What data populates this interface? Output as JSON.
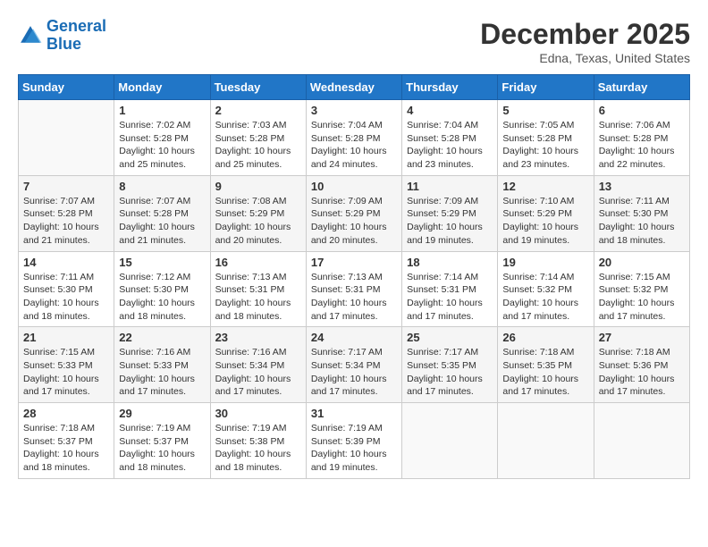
{
  "header": {
    "logo_line1": "General",
    "logo_line2": "Blue",
    "month": "December 2025",
    "location": "Edna, Texas, United States"
  },
  "weekdays": [
    "Sunday",
    "Monday",
    "Tuesday",
    "Wednesday",
    "Thursday",
    "Friday",
    "Saturday"
  ],
  "weeks": [
    [
      {
        "day": "",
        "info": ""
      },
      {
        "day": "1",
        "info": "Sunrise: 7:02 AM\nSunset: 5:28 PM\nDaylight: 10 hours\nand 25 minutes."
      },
      {
        "day": "2",
        "info": "Sunrise: 7:03 AM\nSunset: 5:28 PM\nDaylight: 10 hours\nand 25 minutes."
      },
      {
        "day": "3",
        "info": "Sunrise: 7:04 AM\nSunset: 5:28 PM\nDaylight: 10 hours\nand 24 minutes."
      },
      {
        "day": "4",
        "info": "Sunrise: 7:04 AM\nSunset: 5:28 PM\nDaylight: 10 hours\nand 23 minutes."
      },
      {
        "day": "5",
        "info": "Sunrise: 7:05 AM\nSunset: 5:28 PM\nDaylight: 10 hours\nand 23 minutes."
      },
      {
        "day": "6",
        "info": "Sunrise: 7:06 AM\nSunset: 5:28 PM\nDaylight: 10 hours\nand 22 minutes."
      }
    ],
    [
      {
        "day": "7",
        "info": "Sunrise: 7:07 AM\nSunset: 5:28 PM\nDaylight: 10 hours\nand 21 minutes."
      },
      {
        "day": "8",
        "info": "Sunrise: 7:07 AM\nSunset: 5:28 PM\nDaylight: 10 hours\nand 21 minutes."
      },
      {
        "day": "9",
        "info": "Sunrise: 7:08 AM\nSunset: 5:29 PM\nDaylight: 10 hours\nand 20 minutes."
      },
      {
        "day": "10",
        "info": "Sunrise: 7:09 AM\nSunset: 5:29 PM\nDaylight: 10 hours\nand 20 minutes."
      },
      {
        "day": "11",
        "info": "Sunrise: 7:09 AM\nSunset: 5:29 PM\nDaylight: 10 hours\nand 19 minutes."
      },
      {
        "day": "12",
        "info": "Sunrise: 7:10 AM\nSunset: 5:29 PM\nDaylight: 10 hours\nand 19 minutes."
      },
      {
        "day": "13",
        "info": "Sunrise: 7:11 AM\nSunset: 5:30 PM\nDaylight: 10 hours\nand 18 minutes."
      }
    ],
    [
      {
        "day": "14",
        "info": "Sunrise: 7:11 AM\nSunset: 5:30 PM\nDaylight: 10 hours\nand 18 minutes."
      },
      {
        "day": "15",
        "info": "Sunrise: 7:12 AM\nSunset: 5:30 PM\nDaylight: 10 hours\nand 18 minutes."
      },
      {
        "day": "16",
        "info": "Sunrise: 7:13 AM\nSunset: 5:31 PM\nDaylight: 10 hours\nand 18 minutes."
      },
      {
        "day": "17",
        "info": "Sunrise: 7:13 AM\nSunset: 5:31 PM\nDaylight: 10 hours\nand 17 minutes."
      },
      {
        "day": "18",
        "info": "Sunrise: 7:14 AM\nSunset: 5:31 PM\nDaylight: 10 hours\nand 17 minutes."
      },
      {
        "day": "19",
        "info": "Sunrise: 7:14 AM\nSunset: 5:32 PM\nDaylight: 10 hours\nand 17 minutes."
      },
      {
        "day": "20",
        "info": "Sunrise: 7:15 AM\nSunset: 5:32 PM\nDaylight: 10 hours\nand 17 minutes."
      }
    ],
    [
      {
        "day": "21",
        "info": "Sunrise: 7:15 AM\nSunset: 5:33 PM\nDaylight: 10 hours\nand 17 minutes."
      },
      {
        "day": "22",
        "info": "Sunrise: 7:16 AM\nSunset: 5:33 PM\nDaylight: 10 hours\nand 17 minutes."
      },
      {
        "day": "23",
        "info": "Sunrise: 7:16 AM\nSunset: 5:34 PM\nDaylight: 10 hours\nand 17 minutes."
      },
      {
        "day": "24",
        "info": "Sunrise: 7:17 AM\nSunset: 5:34 PM\nDaylight: 10 hours\nand 17 minutes."
      },
      {
        "day": "25",
        "info": "Sunrise: 7:17 AM\nSunset: 5:35 PM\nDaylight: 10 hours\nand 17 minutes."
      },
      {
        "day": "26",
        "info": "Sunrise: 7:18 AM\nSunset: 5:35 PM\nDaylight: 10 hours\nand 17 minutes."
      },
      {
        "day": "27",
        "info": "Sunrise: 7:18 AM\nSunset: 5:36 PM\nDaylight: 10 hours\nand 17 minutes."
      }
    ],
    [
      {
        "day": "28",
        "info": "Sunrise: 7:18 AM\nSunset: 5:37 PM\nDaylight: 10 hours\nand 18 minutes."
      },
      {
        "day": "29",
        "info": "Sunrise: 7:19 AM\nSunset: 5:37 PM\nDaylight: 10 hours\nand 18 minutes."
      },
      {
        "day": "30",
        "info": "Sunrise: 7:19 AM\nSunset: 5:38 PM\nDaylight: 10 hours\nand 18 minutes."
      },
      {
        "day": "31",
        "info": "Sunrise: 7:19 AM\nSunset: 5:39 PM\nDaylight: 10 hours\nand 19 minutes."
      },
      {
        "day": "",
        "info": ""
      },
      {
        "day": "",
        "info": ""
      },
      {
        "day": "",
        "info": ""
      }
    ]
  ]
}
